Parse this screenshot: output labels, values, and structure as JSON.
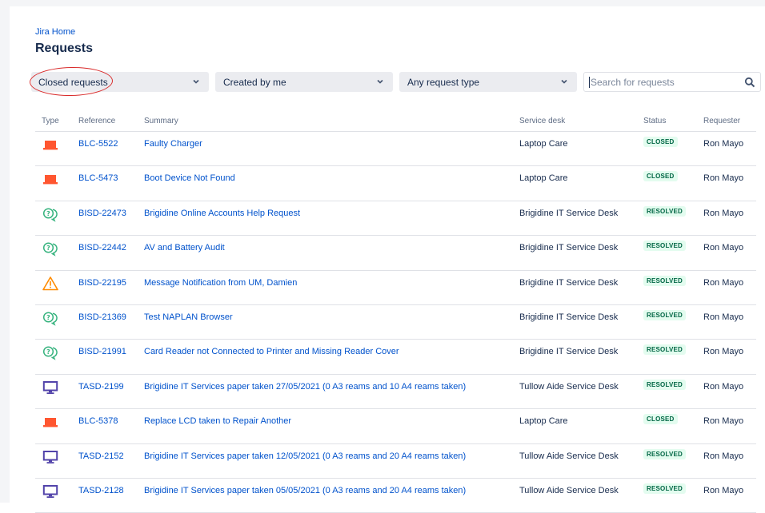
{
  "breadcrumb": "Jira Home",
  "page_title": "Requests",
  "filters": {
    "status": "Closed requests",
    "created": "Created by me",
    "type": "Any request type",
    "search_placeholder": "Search for requests"
  },
  "columns": {
    "type": "Type",
    "reference": "Reference",
    "summary": "Summary",
    "service_desk": "Service desk",
    "status": "Status",
    "requester": "Requester"
  },
  "colors": {
    "link": "#0052cc",
    "laptop_icon": "#ff5630",
    "help_icon": "#36b37e",
    "warning_icon": "#ff8b00",
    "monitor_icon": "#5243aa",
    "annotation": "#d92c2c"
  },
  "rows": [
    {
      "icon": "laptop-icon",
      "ref": "BLC-5522",
      "summary": "Faulty Charger",
      "desk": "Laptop Care",
      "status": "CLOSED",
      "requester": "Ron Mayo"
    },
    {
      "icon": "laptop-icon",
      "ref": "BLC-5473",
      "summary": "Boot Device Not Found",
      "desk": "Laptop Care",
      "status": "CLOSED",
      "requester": "Ron Mayo"
    },
    {
      "icon": "help-icon",
      "ref": "BISD-22473",
      "summary": "Brigidine Online Accounts Help Request",
      "desk": "Brigidine IT Service Desk",
      "status": "RESOLVED",
      "requester": "Ron Mayo"
    },
    {
      "icon": "help-icon",
      "ref": "BISD-22442",
      "summary": "AV and Battery Audit",
      "desk": "Brigidine IT Service Desk",
      "status": "RESOLVED",
      "requester": "Ron Mayo"
    },
    {
      "icon": "warning-icon",
      "ref": "BISD-22195",
      "summary": "Message Notification from UM, Damien",
      "desk": "Brigidine IT Service Desk",
      "status": "RESOLVED",
      "requester": "Ron Mayo"
    },
    {
      "icon": "help-icon",
      "ref": "BISD-21369",
      "summary": "Test NAPLAN Browser",
      "desk": "Brigidine IT Service Desk",
      "status": "RESOLVED",
      "requester": "Ron Mayo"
    },
    {
      "icon": "help-icon",
      "ref": "BISD-21991",
      "summary": "Card Reader not Connected to Printer and Missing Reader Cover",
      "desk": "Brigidine IT Service Desk",
      "status": "RESOLVED",
      "requester": "Ron Mayo"
    },
    {
      "icon": "monitor-icon",
      "ref": "TASD-2199",
      "summary": "Brigidine IT Services paper taken 27/05/2021 (0 A3 reams and 10 A4 reams taken)",
      "desk": "Tullow Aide Service Desk",
      "status": "RESOLVED",
      "requester": "Ron Mayo"
    },
    {
      "icon": "laptop-icon",
      "ref": "BLC-5378",
      "summary": "Replace LCD taken to Repair Another",
      "desk": "Laptop Care",
      "status": "CLOSED",
      "requester": "Ron Mayo"
    },
    {
      "icon": "monitor-icon",
      "ref": "TASD-2152",
      "summary": "Brigidine IT Services paper taken 12/05/2021 (0 A3 reams and 20 A4 reams taken)",
      "desk": "Tullow Aide Service Desk",
      "status": "RESOLVED",
      "requester": "Ron Mayo"
    },
    {
      "icon": "monitor-icon",
      "ref": "TASD-2128",
      "summary": "Brigidine IT Services paper taken 05/05/2021 (0 A3 reams and 20 A4 reams taken)",
      "desk": "Tullow Aide Service Desk",
      "status": "RESOLVED",
      "requester": "Ron Mayo"
    }
  ]
}
